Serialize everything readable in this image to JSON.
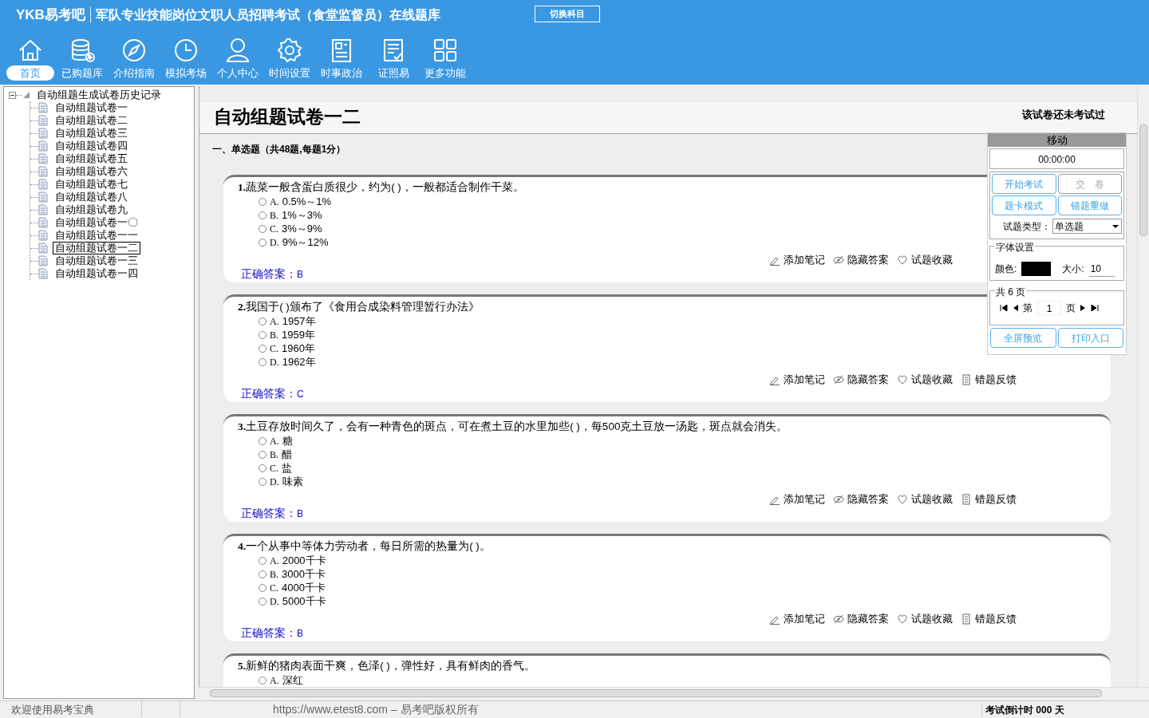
{
  "header": {
    "logo": "YKB易考吧",
    "title": "军队专业技能岗位文职人员招聘考试（食堂监督员）在线题库",
    "switch_button": "切换科目",
    "nav": [
      {
        "label": "首页",
        "selected": true
      },
      {
        "label": "已购题库",
        "selected": false
      },
      {
        "label": "介绍指南",
        "selected": false
      },
      {
        "label": "模拟考场",
        "selected": false
      },
      {
        "label": "个人中心",
        "selected": false
      },
      {
        "label": "时间设置",
        "selected": false
      },
      {
        "label": "时事政治",
        "selected": false
      },
      {
        "label": "证照易",
        "selected": false
      },
      {
        "label": "更多功能",
        "selected": false
      }
    ]
  },
  "tree": {
    "label": "自动组题生成试卷历史记录",
    "expanded": true,
    "children": [
      {
        "label": "自动组题试卷一",
        "selected": false
      },
      {
        "label": "自动组题试卷二",
        "selected": false
      },
      {
        "label": "自动组题试卷三",
        "selected": false
      },
      {
        "label": "自动组题试卷四",
        "selected": false
      },
      {
        "label": "自动组题试卷五",
        "selected": false
      },
      {
        "label": "自动组题试卷六",
        "selected": false
      },
      {
        "label": "自动组题试卷七",
        "selected": false
      },
      {
        "label": "自动组题试卷八",
        "selected": false
      },
      {
        "label": "自动组题试卷九",
        "selected": false
      },
      {
        "label": "自动组题试卷一〇",
        "selected": false
      },
      {
        "label": "自动组题试卷一一",
        "selected": false
      },
      {
        "label": "自动组题试卷一二",
        "selected": true
      },
      {
        "label": "自动组题试卷一三",
        "selected": false
      },
      {
        "label": "自动组题试卷一四",
        "selected": false
      }
    ]
  },
  "exam": {
    "title": "自动组题试卷一二",
    "status": "该试卷还未考试过",
    "section": "一、单选题（共48题,每题1分）",
    "questions": [
      {
        "number": "1.",
        "text": "蔬菜一般含蛋白质很少，约为( )，一般都适合制作干菜。",
        "options": [
          {
            "label": "A.",
            "text": "0.5%～1%",
            "checked": false
          },
          {
            "label": "B.",
            "text": "1%～3%",
            "checked": false
          },
          {
            "label": "C.",
            "text": "3%～9%",
            "checked": false
          },
          {
            "label": "D.",
            "text": "9%～12%",
            "checked": false
          }
        ],
        "answer_label": "正确答案：",
        "answer": "B",
        "actions": [
          "添加笔记",
          "隐藏答案",
          "试题收藏"
        ]
      },
      {
        "number": "2.",
        "text": "我国于( )颁布了《食用合成染料管理暂行办法》",
        "options": [
          {
            "label": "A.",
            "text": "1957年",
            "checked": false
          },
          {
            "label": "B.",
            "text": "1959年",
            "checked": false
          },
          {
            "label": "C.",
            "text": "1960年",
            "checked": false
          },
          {
            "label": "D.",
            "text": "1962年",
            "checked": false
          }
        ],
        "answer_label": "正确答案：",
        "answer": "C",
        "actions": [
          "添加笔记",
          "隐藏答案",
          "试题收藏",
          "错题反馈"
        ]
      },
      {
        "number": "3.",
        "text": "土豆存放时间久了，会有一种青色的斑点，可在煮土豆的水里加些( )，每500克土豆放一汤匙，斑点就会消失。",
        "options": [
          {
            "label": "A.",
            "text": "糖",
            "checked": false
          },
          {
            "label": "B.",
            "text": "醋",
            "checked": false
          },
          {
            "label": "C.",
            "text": "盐",
            "checked": false
          },
          {
            "label": "D.",
            "text": "味素",
            "checked": false
          }
        ],
        "answer_label": "正确答案：",
        "answer": "B",
        "actions": [
          "添加笔记",
          "隐藏答案",
          "试题收藏",
          "错题反馈"
        ]
      },
      {
        "number": "4.",
        "text": "一个从事中等体力劳动者，每日所需的热量为( )。",
        "options": [
          {
            "label": "A.",
            "text": "2000千卡",
            "checked": false
          },
          {
            "label": "B.",
            "text": "3000千卡",
            "checked": false
          },
          {
            "label": "C.",
            "text": "4000千卡",
            "checked": false
          },
          {
            "label": "D.",
            "text": "5000千卡",
            "checked": false
          }
        ],
        "answer_label": "正确答案：",
        "answer": "B",
        "actions": [
          "添加笔记",
          "隐藏答案",
          "试题收藏",
          "错题反馈"
        ]
      },
      {
        "number": "5.",
        "text": "新鲜的猪肉表面干爽，色泽( )，弹性好，具有鲜肉的香气。",
        "options": [
          {
            "label": "A.",
            "text": "深红",
            "checked": false
          }
        ]
      }
    ]
  },
  "panel": {
    "title": "移动",
    "timer": "00:00:00",
    "buttons": [
      {
        "label": "开始考试",
        "disabled": false
      },
      {
        "label": "交　卷",
        "disabled": true
      },
      {
        "label": "题卡模式",
        "disabled": false
      },
      {
        "label": "错题重做",
        "disabled": false
      }
    ],
    "type_label": "试题类型：",
    "type_value": "单选题",
    "font_legend": "字体设置",
    "color_label": "颜色:",
    "size_label": "大小:",
    "size_value": "10",
    "page_legend": "共 6 页",
    "page_prefix": "第",
    "page_value": "1",
    "page_suffix": "页",
    "bottom_buttons": [
      "全屏预览",
      "打印入口"
    ]
  },
  "status_bar": {
    "left": "欢迎使用易考宝典",
    "center": "https://www.etest8.com – 易考吧版权所有",
    "right": "考试倒计时 000 天"
  }
}
